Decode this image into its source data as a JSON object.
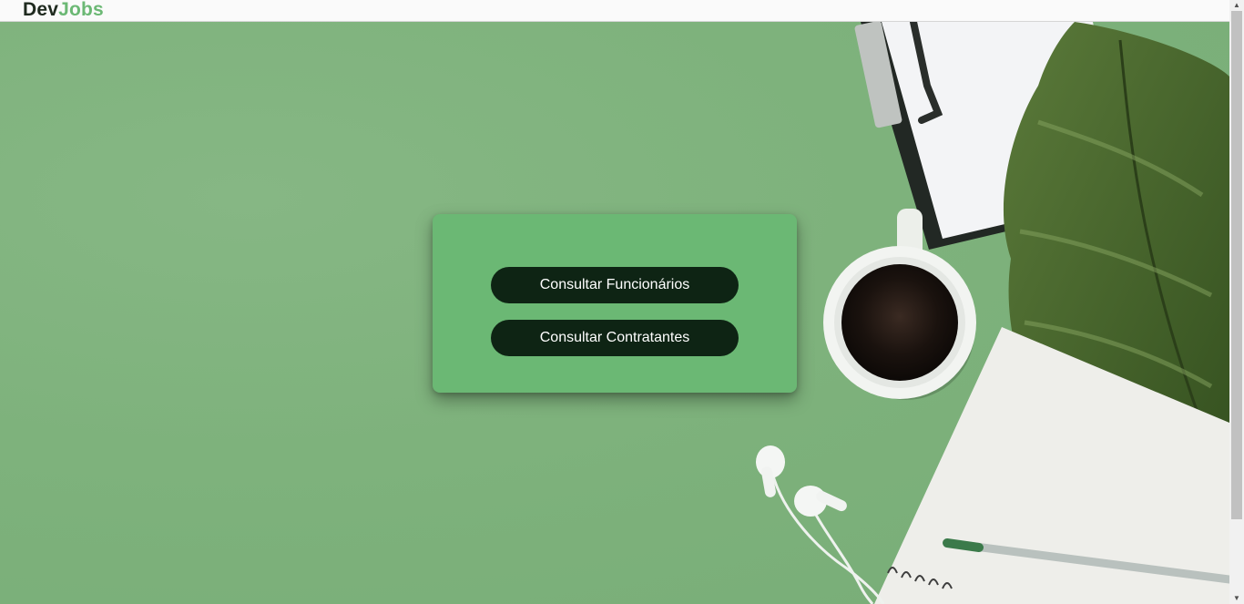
{
  "header": {
    "logo_part1": "Dev",
    "logo_part2": "Jobs"
  },
  "card": {
    "buttons": [
      {
        "label": "Consultar Funcionários"
      },
      {
        "label": "Consultar Contratantes"
      }
    ]
  },
  "colors": {
    "brand_green": "#6bb874",
    "button_dark": "#0e2414",
    "background_green": "#7fb27d"
  },
  "scrollbar": {
    "up_icon": "arrow-up-icon",
    "down_icon": "arrow-down-icon"
  }
}
